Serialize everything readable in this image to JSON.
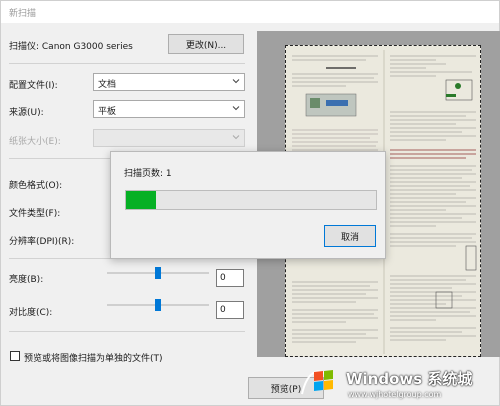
{
  "window": {
    "title": "新扫描"
  },
  "scanner": {
    "label": "扫描仪: Canon G3000 series",
    "change_button": "更改(N)..."
  },
  "form": {
    "profile_label": "配置文件(I):",
    "profile_value": "文档",
    "source_label": "来源(U):",
    "source_value": "平板",
    "paper_size_label": "纸张大小(E):",
    "paper_size_value": "",
    "color_format_label": "颜色格式(O):",
    "file_type_label": "文件类型(F):",
    "resolution_label": "分辨率(DPI)(R):",
    "brightness_label": "亮度(B):",
    "brightness_value": "0",
    "contrast_label": "对比度(C):",
    "contrast_value": "0",
    "separate_files_label": "预览或将图像扫描为单独的文件(T)"
  },
  "footer": {
    "preview_button": "预览(P)"
  },
  "progress_dialog": {
    "pages_label": "扫描页数: 1",
    "progress_fraction": 0.12,
    "cancel_button": "取消"
  },
  "watermark": {
    "brand": "Windows 系统城",
    "url": "www.wjhotelgroup.com"
  },
  "colors": {
    "accent": "#0078d7",
    "progress": "#06b025",
    "preview_bg": "#a0a0a0"
  }
}
